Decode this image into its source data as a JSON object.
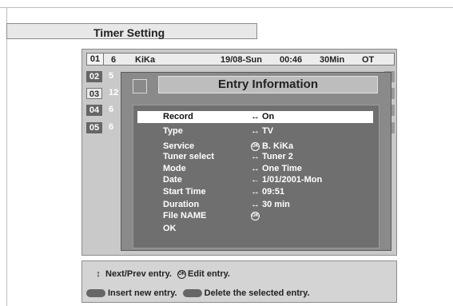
{
  "title": "Timer Setting",
  "timer_list": {
    "rows": [
      {
        "num": "01",
        "ch": "6",
        "station": "KiKa",
        "date": "19/08-Sun",
        "time": "00:46",
        "duration": "30Min",
        "type": "OT"
      },
      {
        "num": "02",
        "ch": "5"
      },
      {
        "num": "03",
        "ch": "12"
      },
      {
        "num": "04",
        "ch": "6"
      },
      {
        "num": "05",
        "ch": "6"
      }
    ]
  },
  "popup": {
    "title": "Entry Information",
    "entries": [
      {
        "label": "Record",
        "arrow": "↔",
        "value": "On",
        "selected": true
      },
      {
        "label": "Type",
        "arrow": "↔",
        "value": "TV"
      },
      {
        "label": "Service",
        "arrow": "ok",
        "value": "B. KiKa"
      },
      {
        "label": "Tuner select",
        "arrow": "↔",
        "value": "Tuner 2"
      },
      {
        "label": "Mode",
        "arrow": "↔",
        "value": "One Time"
      },
      {
        "label": "Date",
        "arrow": "←",
        "value": "1/01/2001-Mon"
      },
      {
        "label": "Start Time",
        "arrow": "↔",
        "value": "09:51"
      },
      {
        "label": "Duration",
        "arrow": "↔",
        "value": "30 min"
      },
      {
        "label": "File NAME",
        "arrow": "ok",
        "value": ""
      },
      {
        "label": "OK",
        "arrow": "",
        "value": ""
      }
    ]
  },
  "footer": {
    "nav_hint": "Next/Prev entry.",
    "edit_hint": "Edit entry.",
    "insert_hint": "Insert new entry.",
    "delete_hint": "Delete the selected entry.",
    "ok_icon_text": "OK"
  },
  "colors": {
    "selected_bg": "#ffffff",
    "panel_bg": "#6f6f6f",
    "list_bg": "#c9c9c9"
  }
}
